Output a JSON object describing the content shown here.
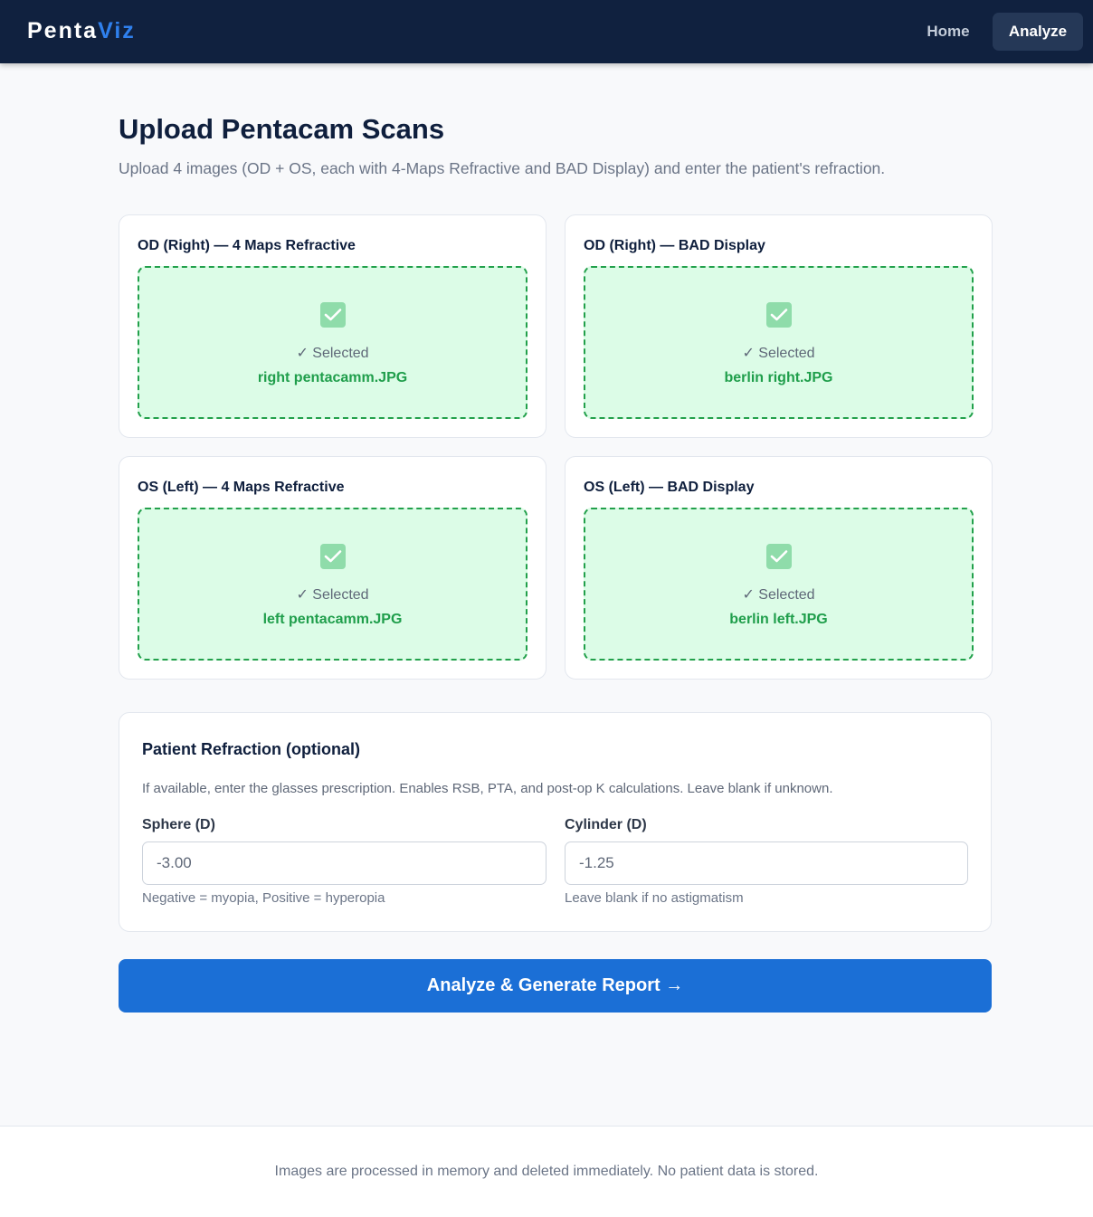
{
  "nav": {
    "brand_part1": "Penta",
    "brand_part2": "Viz",
    "home_label": "Home",
    "analyze_label": "Analyze"
  },
  "header": {
    "title": "Upload Pentacam Scans",
    "subtitle": "Upload 4 images (OD + OS, each with 4-Maps Refractive and BAD Display) and enter the patient's refraction."
  },
  "uploads": [
    {
      "label": "OD (Right) — 4 Maps Refractive",
      "status": "✓ Selected",
      "filename": "right pentacamm.JPG"
    },
    {
      "label": "OD (Right) — BAD Display",
      "status": "✓ Selected",
      "filename": "berlin right.JPG"
    },
    {
      "label": "OS (Left) — 4 Maps Refractive",
      "status": "✓ Selected",
      "filename": "left pentacamm.JPG"
    },
    {
      "label": "OS (Left) — BAD Display",
      "status": "✓ Selected",
      "filename": "berlin left.JPG"
    }
  ],
  "refraction": {
    "title": "Patient Refraction (optional)",
    "description": "If available, enter the glasses prescription. Enables RSB, PTA, and post-op K calculations. Leave blank if unknown.",
    "sphere": {
      "label": "Sphere (D)",
      "value": "-3.00",
      "hint": "Negative = myopia, Positive = hyperopia"
    },
    "cylinder": {
      "label": "Cylinder (D)",
      "value": "-1.25",
      "hint": "Leave blank if no astigmatism"
    }
  },
  "submit_label": "Analyze & Generate Report →",
  "footer_text": "Images are processed in memory and deleted immediately. No patient data is stored.",
  "colors": {
    "navbar": "#10213f",
    "accent": "#1b6fd6",
    "success": "#1f9e4b",
    "success_bg": "#dcfce7"
  }
}
